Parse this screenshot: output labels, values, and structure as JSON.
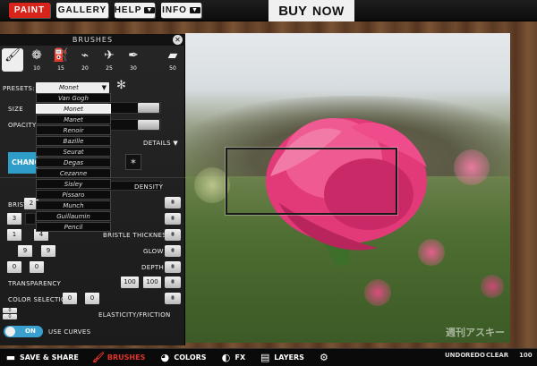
{
  "topbar": {
    "paint": "PAINT",
    "gallery": "GALLERY",
    "help": "HELP",
    "info": "INFO",
    "caret": "▼",
    "buy": "BUY",
    "now": "NOW"
  },
  "panel": {
    "title": "BRUSHES",
    "close": "✕",
    "tools": [
      {
        "icon": "brush-icon",
        "glyph": "🖌",
        "num": ""
      },
      {
        "icon": "sponge-icon",
        "glyph": "❁",
        "num": "10"
      },
      {
        "icon": "bucket-icon",
        "glyph": "⛽",
        "num": "15"
      },
      {
        "icon": "spray-icon",
        "glyph": "⌁",
        "num": "20"
      },
      {
        "icon": "airbrush-icon",
        "glyph": "✈",
        "num": "25"
      },
      {
        "icon": "pen-icon",
        "glyph": "✒",
        "num": "30"
      },
      {
        "icon": "eraser-icon",
        "glyph": "▰",
        "num": "50"
      }
    ],
    "presets_label": "PRESETS:",
    "preset_selected": "Monet",
    "presets": [
      "Van Gogh",
      "Monet",
      "Manet",
      "Renoir",
      "Bazille",
      "Seurat",
      "Degas",
      "Cezanne",
      "Sisley",
      "Pissaro",
      "Munch",
      "Guillaumin",
      "Pencil"
    ],
    "size_label": "SIZE",
    "opacity_label": "OPACITY",
    "details": "DETAILS",
    "change": "CHANGE",
    "density": "DENSITY",
    "bristle_short": "BRIST",
    "bristle_thickness": "BRISTLE THICKNESS",
    "glow": "GLOW",
    "depth": "DEPTH",
    "transparency": "TRANSPARENCY",
    "color_selection": "COLOR SELECTION",
    "elasticity": "ELASTICITY/FRICTION",
    "toggle_state": "ON",
    "use_curves": "USE CURVES",
    "values": {
      "brist": "2",
      "v3": "3",
      "b1": "1",
      "b4": "4",
      "g9a": "9",
      "g9b": "9",
      "d0a": "0",
      "d0b": "0",
      "t100a": "100",
      "t100b": "100",
      "c0a": "0",
      "c0b": "0",
      "e0a": "0",
      "e0b": "0"
    },
    "wave": "⩩"
  },
  "bottombar": {
    "save_share": "SAVE & SHARE",
    "brushes": "BRUSHES",
    "colors": "COLORS",
    "fx": "FX",
    "layers": "LAYERS",
    "undo": "UNDO",
    "redo": "REDO",
    "clear": "CLEAR",
    "zoom": "100"
  },
  "watermark": "週刊アスキー",
  "colors": {
    "accent_red": "#d8241b",
    "accent_blue": "#2e9ec9",
    "rose": "#e23a78"
  }
}
